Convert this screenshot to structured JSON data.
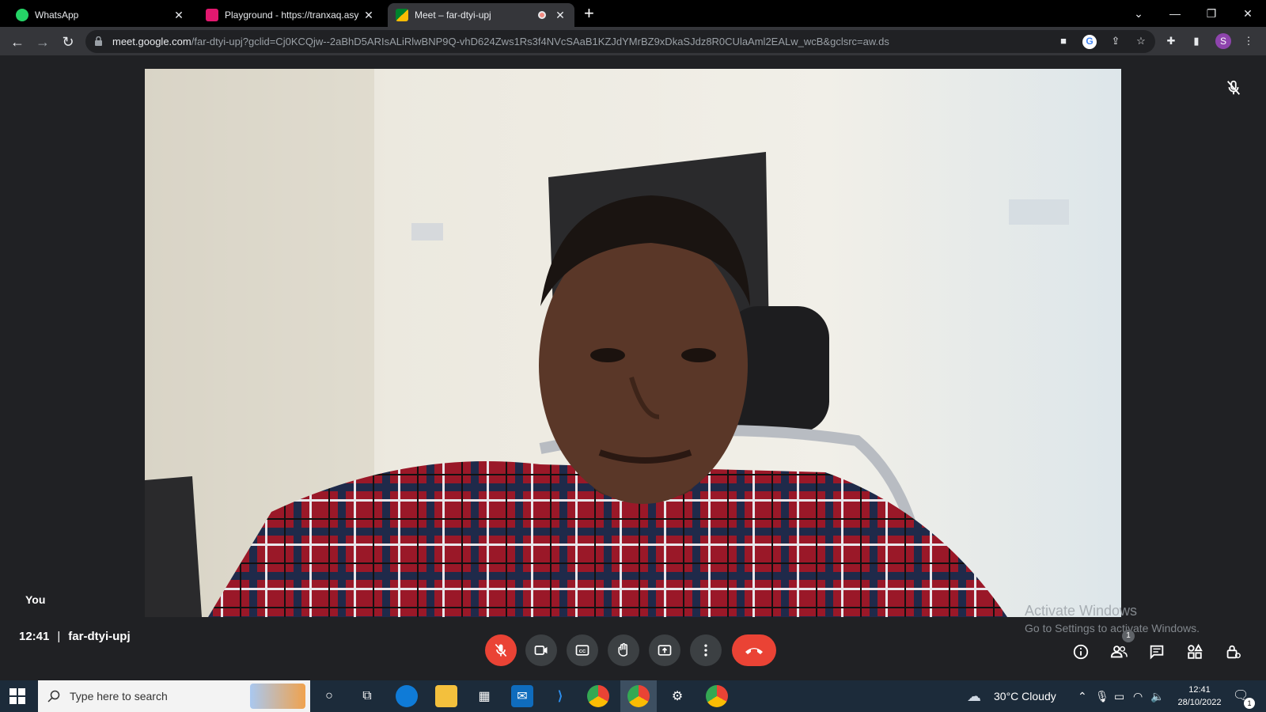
{
  "browser": {
    "tabs": [
      {
        "title": "WhatsApp",
        "favicon_color": "#25d366"
      },
      {
        "title": "Playground - https://tranxaq.asy",
        "favicon_color": "#e2186f"
      },
      {
        "title": "Meet – far-dtyi-upj",
        "favicon_color": "#00832d"
      }
    ],
    "new_tab": "+",
    "url_host": "meet.google.com",
    "url_path": "/far-dtyi-upj?gclid=Cj0KCQjw--2aBhD5ARIsALiRlwBNP9Q-vhD624Zws1Rs3f4NVcSAaB1KZJdYMrBZ9xDkaSJdz8R0CUlaAml2EALw_wcB&gclsrc=aw.ds",
    "profile_initial": "S"
  },
  "meet": {
    "self_label": "You",
    "time": "12:41",
    "meeting_code": "far-dtyi-upj",
    "participant_count": "1"
  },
  "watermark": {
    "line1": "Activate Windows",
    "line2": "Go to Settings to activate Windows."
  },
  "taskbar": {
    "search_placeholder": "Type here to search",
    "weather": "30°C  Cloudy",
    "time": "12:41",
    "date": "28/10/2022",
    "notification_count": "1"
  },
  "colors": {
    "end_call": "#ea4335",
    "mic_off": "#ea4335",
    "meet_bg": "#202124"
  }
}
